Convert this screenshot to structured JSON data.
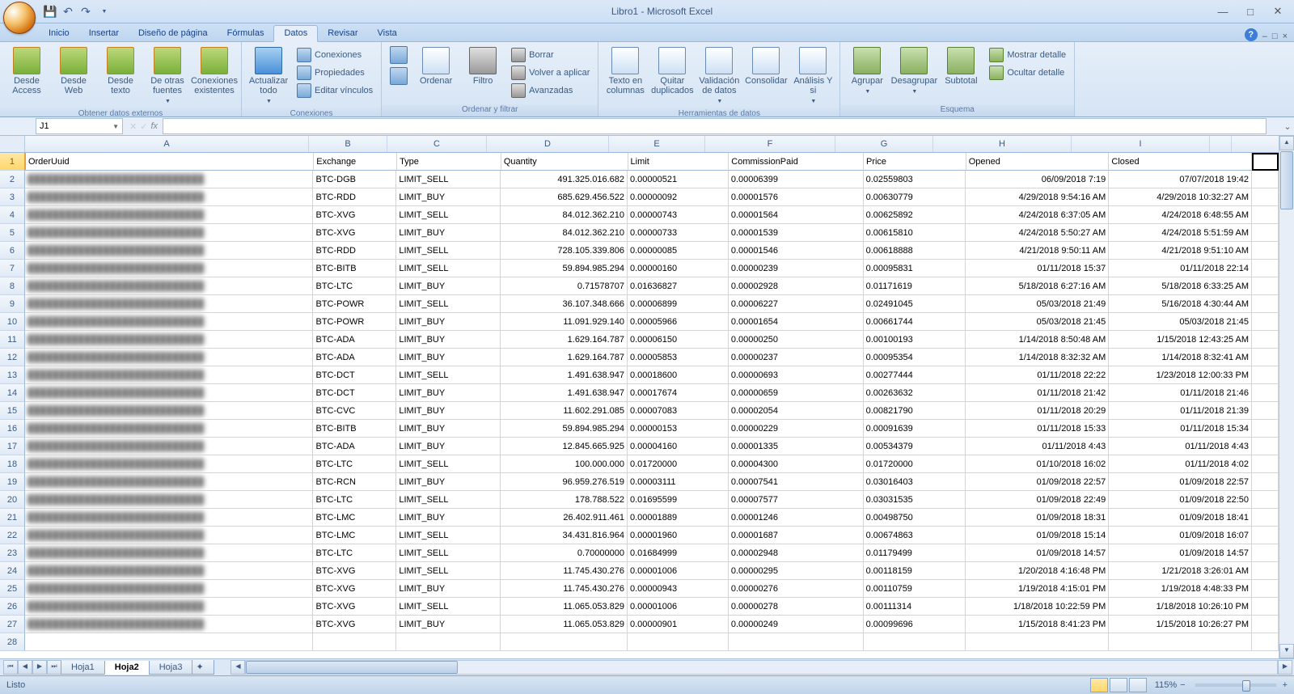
{
  "title": "Libro1 - Microsoft Excel",
  "qat": {
    "save": "💾",
    "undo": "↶",
    "redo": "↷"
  },
  "tabs": [
    "Inicio",
    "Insertar",
    "Diseño de página",
    "Fórmulas",
    "Datos",
    "Revisar",
    "Vista"
  ],
  "active_tab": 4,
  "ribbon": {
    "g1": {
      "label": "Obtener datos externos",
      "btns": [
        "Desde Access",
        "Desde Web",
        "Desde texto",
        "De otras fuentes",
        "Conexiones existentes"
      ]
    },
    "g2": {
      "label": "Conexiones",
      "main": "Actualizar todo",
      "items": [
        "Conexiones",
        "Propiedades",
        "Editar vínculos"
      ]
    },
    "g3": {
      "label": "Ordenar y filtrar",
      "sort": "Ordenar",
      "filter": "Filtro",
      "items": [
        "Borrar",
        "Volver a aplicar",
        "Avanzadas"
      ]
    },
    "g4": {
      "label": "Herramientas de datos",
      "btns": [
        "Texto en columnas",
        "Quitar duplicados",
        "Validación de datos",
        "Consolidar",
        "Análisis Y si"
      ]
    },
    "g5": {
      "label": "Esquema",
      "btns": [
        "Agrupar",
        "Desagrupar",
        "Subtotal"
      ],
      "items": [
        "Mostrar detalle",
        "Ocultar detalle"
      ]
    }
  },
  "namebox": "J1",
  "fx_label": "fx",
  "columns": [
    "A",
    "B",
    "C",
    "D",
    "E",
    "F",
    "G",
    "H",
    "I"
  ],
  "headers_row": [
    "OrderUuid",
    "Exchange",
    "Type",
    "Quantity",
    "Limit",
    "CommissionPaid",
    "Price",
    "Opened",
    "Closed"
  ],
  "rows": [
    [
      "",
      "BTC-DGB",
      "LIMIT_SELL",
      "491.325.016.682",
      "0.00000521",
      "0.00006399",
      "0.02559803",
      "06/09/2018 7:19",
      "07/07/2018 19:42"
    ],
    [
      "",
      "BTC-RDD",
      "LIMIT_BUY",
      "685.629.456.522",
      "0.00000092",
      "0.00001576",
      "0.00630779",
      "4/29/2018 9:54:16 AM",
      "4/29/2018 10:32:27 AM"
    ],
    [
      "",
      "BTC-XVG",
      "LIMIT_SELL",
      "84.012.362.210",
      "0.00000743",
      "0.00001564",
      "0.00625892",
      "4/24/2018 6:37:05 AM",
      "4/24/2018 6:48:55 AM"
    ],
    [
      "",
      "BTC-XVG",
      "LIMIT_BUY",
      "84.012.362.210",
      "0.00000733",
      "0.00001539",
      "0.00615810",
      "4/24/2018 5:50:27 AM",
      "4/24/2018 5:51:59 AM"
    ],
    [
      "",
      "BTC-RDD",
      "LIMIT_SELL",
      "728.105.339.806",
      "0.00000085",
      "0.00001546",
      "0.00618888",
      "4/21/2018 9:50:11 AM",
      "4/21/2018 9:51:10 AM"
    ],
    [
      "",
      "BTC-BITB",
      "LIMIT_SELL",
      "59.894.985.294",
      "0.00000160",
      "0.00000239",
      "0.00095831",
      "01/11/2018 15:37",
      "01/11/2018 22:14"
    ],
    [
      "",
      "BTC-LTC",
      "LIMIT_BUY",
      "0.71578707",
      "0.01636827",
      "0.00002928",
      "0.01171619",
      "5/18/2018 6:27:16 AM",
      "5/18/2018 6:33:25 AM"
    ],
    [
      "",
      "BTC-POWR",
      "LIMIT_SELL",
      "36.107.348.666",
      "0.00006899",
      "0.00006227",
      "0.02491045",
      "05/03/2018 21:49",
      "5/16/2018 4:30:44 AM"
    ],
    [
      "",
      "BTC-POWR",
      "LIMIT_BUY",
      "11.091.929.140",
      "0.00005966",
      "0.00001654",
      "0.00661744",
      "05/03/2018 21:45",
      "05/03/2018 21:45"
    ],
    [
      "",
      "BTC-ADA",
      "LIMIT_BUY",
      "1.629.164.787",
      "0.00006150",
      "0.00000250",
      "0.00100193",
      "1/14/2018 8:50:48 AM",
      "1/15/2018 12:43:25 AM"
    ],
    [
      "",
      "BTC-ADA",
      "LIMIT_BUY",
      "1.629.164.787",
      "0.00005853",
      "0.00000237",
      "0.00095354",
      "1/14/2018 8:32:32 AM",
      "1/14/2018 8:32:41 AM"
    ],
    [
      "",
      "BTC-DCT",
      "LIMIT_SELL",
      "1.491.638.947",
      "0.00018600",
      "0.00000693",
      "0.00277444",
      "01/11/2018 22:22",
      "1/23/2018 12:00:33 PM"
    ],
    [
      "",
      "BTC-DCT",
      "LIMIT_BUY",
      "1.491.638.947",
      "0.00017674",
      "0.00000659",
      "0.00263632",
      "01/11/2018 21:42",
      "01/11/2018 21:46"
    ],
    [
      "",
      "BTC-CVC",
      "LIMIT_BUY",
      "11.602.291.085",
      "0.00007083",
      "0.00002054",
      "0.00821790",
      "01/11/2018 20:29",
      "01/11/2018 21:39"
    ],
    [
      "",
      "BTC-BITB",
      "LIMIT_BUY",
      "59.894.985.294",
      "0.00000153",
      "0.00000229",
      "0.00091639",
      "01/11/2018 15:33",
      "01/11/2018 15:34"
    ],
    [
      "",
      "BTC-ADA",
      "LIMIT_BUY",
      "12.845.665.925",
      "0.00004160",
      "0.00001335",
      "0.00534379",
      "01/11/2018 4:43",
      "01/11/2018 4:43"
    ],
    [
      "",
      "BTC-LTC",
      "LIMIT_SELL",
      "100.000.000",
      "0.01720000",
      "0.00004300",
      "0.01720000",
      "01/10/2018 16:02",
      "01/11/2018 4:02"
    ],
    [
      "",
      "BTC-RCN",
      "LIMIT_BUY",
      "96.959.276.519",
      "0.00003111",
      "0.00007541",
      "0.03016403",
      "01/09/2018 22:57",
      "01/09/2018 22:57"
    ],
    [
      "",
      "BTC-LTC",
      "LIMIT_SELL",
      "178.788.522",
      "0.01695599",
      "0.00007577",
      "0.03031535",
      "01/09/2018 22:49",
      "01/09/2018 22:50"
    ],
    [
      "",
      "BTC-LMC",
      "LIMIT_BUY",
      "26.402.911.461",
      "0.00001889",
      "0.00001246",
      "0.00498750",
      "01/09/2018 18:31",
      "01/09/2018 18:41"
    ],
    [
      "",
      "BTC-LMC",
      "LIMIT_SELL",
      "34.431.816.964",
      "0.00001960",
      "0.00001687",
      "0.00674863",
      "01/09/2018 15:14",
      "01/09/2018 16:07"
    ],
    [
      "",
      "BTC-LTC",
      "LIMIT_SELL",
      "0.70000000",
      "0.01684999",
      "0.00002948",
      "0.01179499",
      "01/09/2018 14:57",
      "01/09/2018 14:57"
    ],
    [
      "",
      "BTC-XVG",
      "LIMIT_SELL",
      "11.745.430.276",
      "0.00001006",
      "0.00000295",
      "0.00118159",
      "1/20/2018 4:16:48 PM",
      "1/21/2018 3:26:01 AM"
    ],
    [
      "",
      "BTC-XVG",
      "LIMIT_BUY",
      "11.745.430.276",
      "0.00000943",
      "0.00000276",
      "0.00110759",
      "1/19/2018 4:15:01 PM",
      "1/19/2018 4:48:33 PM"
    ],
    [
      "",
      "BTC-XVG",
      "LIMIT_SELL",
      "11.065.053.829",
      "0.00001006",
      "0.00000278",
      "0.00111314",
      "1/18/2018 10:22:59 PM",
      "1/18/2018 10:26:10 PM"
    ],
    [
      "",
      "BTC-XVG",
      "LIMIT_BUY",
      "11.065.053.829",
      "0.00000901",
      "0.00000249",
      "0.00099696",
      "1/15/2018 8:41:23 PM",
      "1/15/2018 10:26:27 PM"
    ]
  ],
  "sheet_tabs": [
    "Hoja1",
    "Hoja2",
    "Hoja3"
  ],
  "active_sheet": 1,
  "status_text": "Listo",
  "zoom": "115%"
}
